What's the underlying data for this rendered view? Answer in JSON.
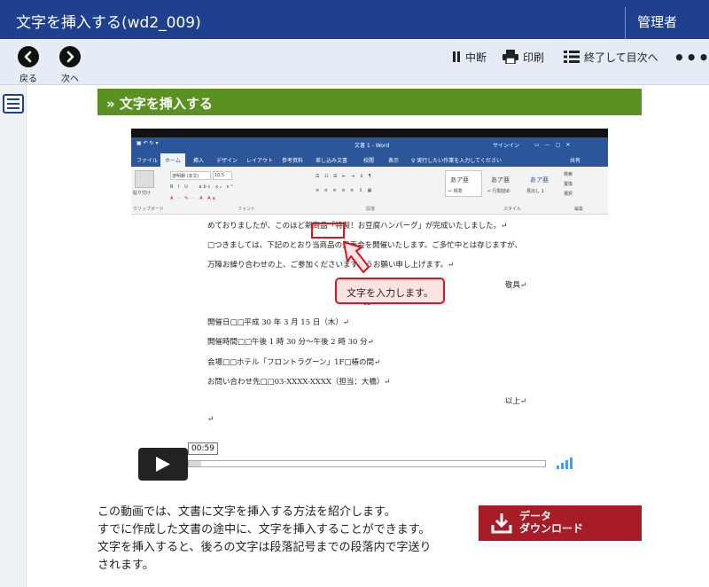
{
  "app": {
    "title": "文字を挿入する(wd2_009)",
    "user": "管理者"
  },
  "toolbar": {
    "back_label": "戻る",
    "next_label": "次へ",
    "pause_label": "中断",
    "print_label": "印刷",
    "finish_label": "終了して目次へ",
    "more_label": "•••"
  },
  "section": {
    "title": "» 文字を挿入する"
  },
  "video": {
    "word_title": "文書 1 - Word",
    "signin": "サインイン",
    "tabs": [
      "ファイル",
      "ホーム",
      "挿入",
      "デザイン",
      "レイアウト",
      "参考資料",
      "差し込み文書",
      "校閲",
      "表示",
      "♀ 実行したい作業を入力してください",
      "共有"
    ],
    "ribbon": {
      "clipboard": "クリップボード",
      "font_group": "フォント",
      "paragraph_group": "段落",
      "style_group": "スタイル",
      "edit_group": "編集",
      "paste": "貼り付け",
      "font_name": "游明朝 (本文)",
      "font_size": "10.5",
      "styles": [
        "あア亜",
        "あア亜",
        "あア亜"
      ],
      "style_names": [
        "↵ 標準",
        "↵ 行間詰め",
        "見出し 1"
      ],
      "edit_items": [
        "検索",
        "置換",
        "選択"
      ]
    },
    "doc_lines": [
      "めておりましたが、このほど新商品「特製！お豆腐ハンバーグ」が完成いたしました。↵",
      "□つきましては、下記のとおり当商品の発表会を開催いたします。ご多忙中とは存じますが、",
      "万障お繰り合わせの上、ご参加くださいますようお願い申し上げます。↵",
      "敬具↵",
      "記↵",
      "開催日□□平成 30 年 3 月 15 日（木）↵",
      "開催時間□□午後 1 時 30 分～午後 2 時 30 分↵",
      "会場□□ホテル「フロントラグーン」1F□椿の間↵",
      "お問い合わせ先□□03-XXXX-XXXX（担当：大橋）↵",
      "以上↵",
      "↵"
    ],
    "callout": "文字を入力します。",
    "time": "00:59",
    "progress": 0.035
  },
  "description": [
    "この動画では、文書に文字を挿入する方法を紹介します。",
    "すでに作成した文書の途中に、文字を挿入することができます。",
    "文字を挿入すると、後ろの文字は段落記号までの段落内で字送り",
    "されます。"
  ],
  "download": {
    "line1": "データ",
    "line2": "ダウンロード"
  },
  "colors": {
    "header": "#1f3f8f",
    "section": "#5a9222",
    "download": "#a81c26",
    "accent": "#d8141e"
  }
}
